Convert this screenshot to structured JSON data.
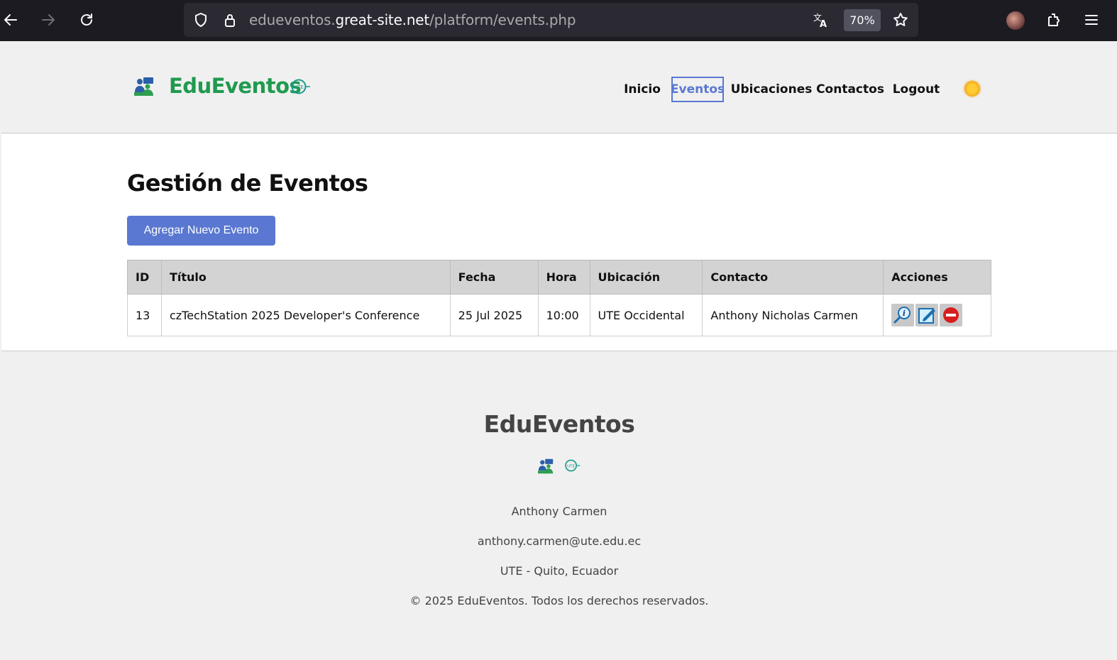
{
  "browser": {
    "url_prefix": "edueventos.",
    "url_domain": "great-site.net",
    "url_path": "/platform/events.php",
    "zoom": "70%",
    "icons": [
      "back-arrow-icon",
      "forward-arrow-icon",
      "reload-icon",
      "shield-icon",
      "lock-icon",
      "translate-icon",
      "star-icon",
      "avatar",
      "extensions-icon",
      "menu-icon"
    ]
  },
  "header": {
    "brand": "EduEventos",
    "nav": [
      {
        "label": "Inicio"
      },
      {
        "label": "Eventos",
        "active": true
      },
      {
        "label": "Ubicaciones"
      },
      {
        "label": "Contactos"
      },
      {
        "label": "Logout"
      }
    ],
    "theme_icon": "sun-icon"
  },
  "main": {
    "title": "Gestión de Eventos",
    "add_button": "Agregar Nuevo Evento",
    "table": {
      "columns": [
        "ID",
        "Título",
        "Fecha",
        "Hora",
        "Ubicación",
        "Contacto",
        "Acciones"
      ],
      "rows": [
        {
          "id": "13",
          "titulo": "czTechStation 2025 Developer's Conference",
          "fecha": "25 Jul 2025",
          "hora": "10:00",
          "ubicacion": "UTE Occidental",
          "contacto": "Anthony Nicholas Carmen",
          "actions": [
            "view-info-icon",
            "edit-icon",
            "delete-icon"
          ]
        }
      ]
    }
  },
  "footer": {
    "brand": "EduEventos",
    "name": "Anthony Carmen",
    "email": "anthony.carmen@ute.edu.ec",
    "location": "UTE - Quito, Ecuador",
    "copyright": "© 2025 EduEventos. Todos los derechos reservados."
  },
  "colors": {
    "brand_green": "#1f9a50",
    "accent_blue": "#5a78d1",
    "delete_red": "#d81e1e"
  }
}
